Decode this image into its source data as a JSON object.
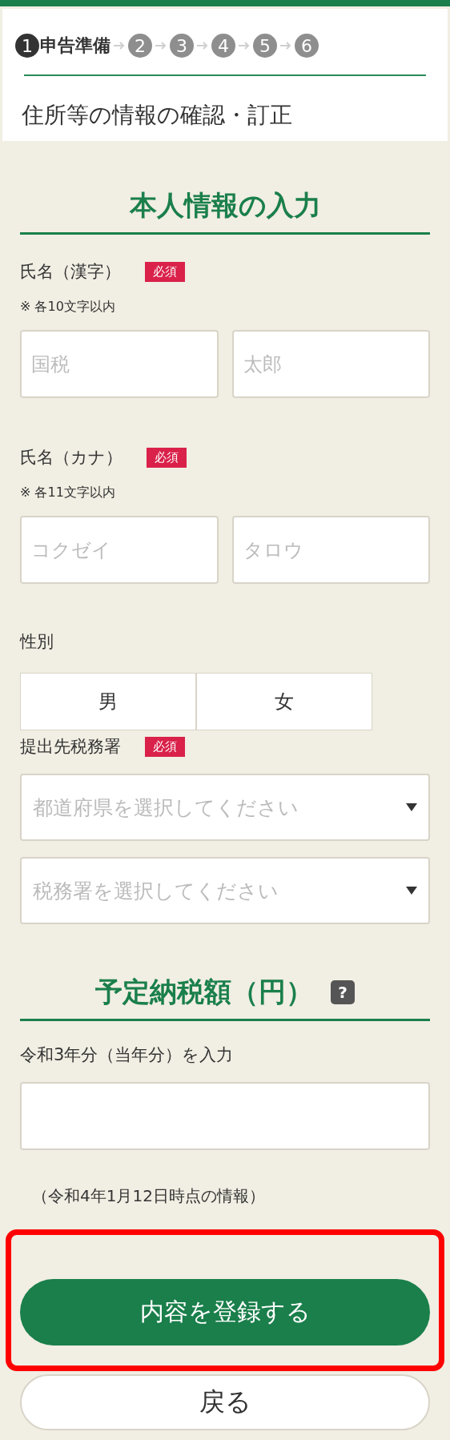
{
  "steps": [
    {
      "number": "1",
      "label": "申告準備",
      "selected": true
    },
    {
      "number": "2",
      "selected": false
    },
    {
      "number": "3",
      "selected": false
    },
    {
      "number": "4",
      "selected": false
    },
    {
      "number": "5",
      "selected": false
    },
    {
      "number": "6",
      "selected": false
    }
  ],
  "page_title": "住所等の情報の確認・訂正",
  "personal_section": {
    "heading": "本人情報の入力",
    "name_kanji": {
      "label": "氏名（漢字）",
      "badge": "必須",
      "note": "※ 各10文字以内",
      "fields": [
        {
          "placeholder": "国税"
        },
        {
          "placeholder": "太郎"
        }
      ]
    },
    "name_kana": {
      "label": "氏名（カナ）",
      "badge": "必須",
      "note": "※ 各11文字以内",
      "fields": [
        {
          "placeholder": "コクゼイ"
        },
        {
          "placeholder": "タロウ"
        }
      ]
    },
    "gender": {
      "label": "性別",
      "options": [
        {
          "label": "男",
          "selected": false
        },
        {
          "label": "女",
          "selected": false
        }
      ]
    },
    "tax_office": {
      "label": "提出先税務署",
      "badge": "必須",
      "selects": [
        {
          "placeholder": "都道府県を選択してください"
        },
        {
          "placeholder": "税務署を選択してください"
        }
      ]
    }
  },
  "tax_section": {
    "heading": "予定納税額（円）",
    "help_icon": "?",
    "field_label": "令和3年分（当年分）を入力",
    "note": "（令和4年1月12日時点の情報）"
  },
  "buttons": [
    {
      "label": "内容を登録する",
      "kind": "primary",
      "highlighted": true
    },
    {
      "label": "戻る",
      "kind": "secondary",
      "highlighted": false
    }
  ]
}
